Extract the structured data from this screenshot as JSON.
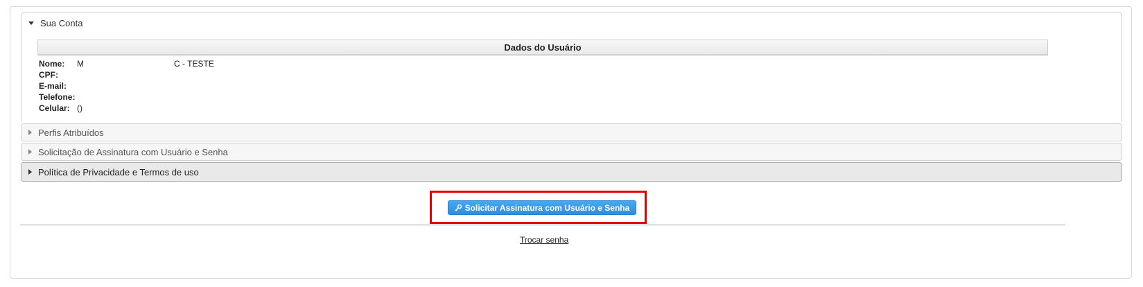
{
  "account_panel": {
    "title": "Sua Conta",
    "table_header": "Dados do Usuário",
    "fields": [
      {
        "label": "Nome:",
        "value": "M                                       C - TESTE"
      },
      {
        "label": "CPF:",
        "value": ""
      },
      {
        "label": "E-mail:",
        "value": ""
      },
      {
        "label": "Telefone:",
        "value": ""
      },
      {
        "label": "Celular:",
        "value": "()"
      }
    ]
  },
  "collapsed_panels": [
    {
      "title": "Perfis Atribuídos"
    },
    {
      "title": "Solicitação de Assinatura com Usuário e Senha"
    },
    {
      "title": "Política de Privacidade e Termos de uso"
    }
  ],
  "actions": {
    "request_signature_label": "Solicitar Assinatura com Usuário e Senha",
    "change_password_label": "Trocar senha"
  },
  "colors": {
    "button_blue": "#2b8ee0",
    "highlight_red": "#e30000"
  },
  "icons": {
    "expanded": "caret-down-icon",
    "collapsed": "caret-right-icon",
    "button": "key-icon"
  }
}
